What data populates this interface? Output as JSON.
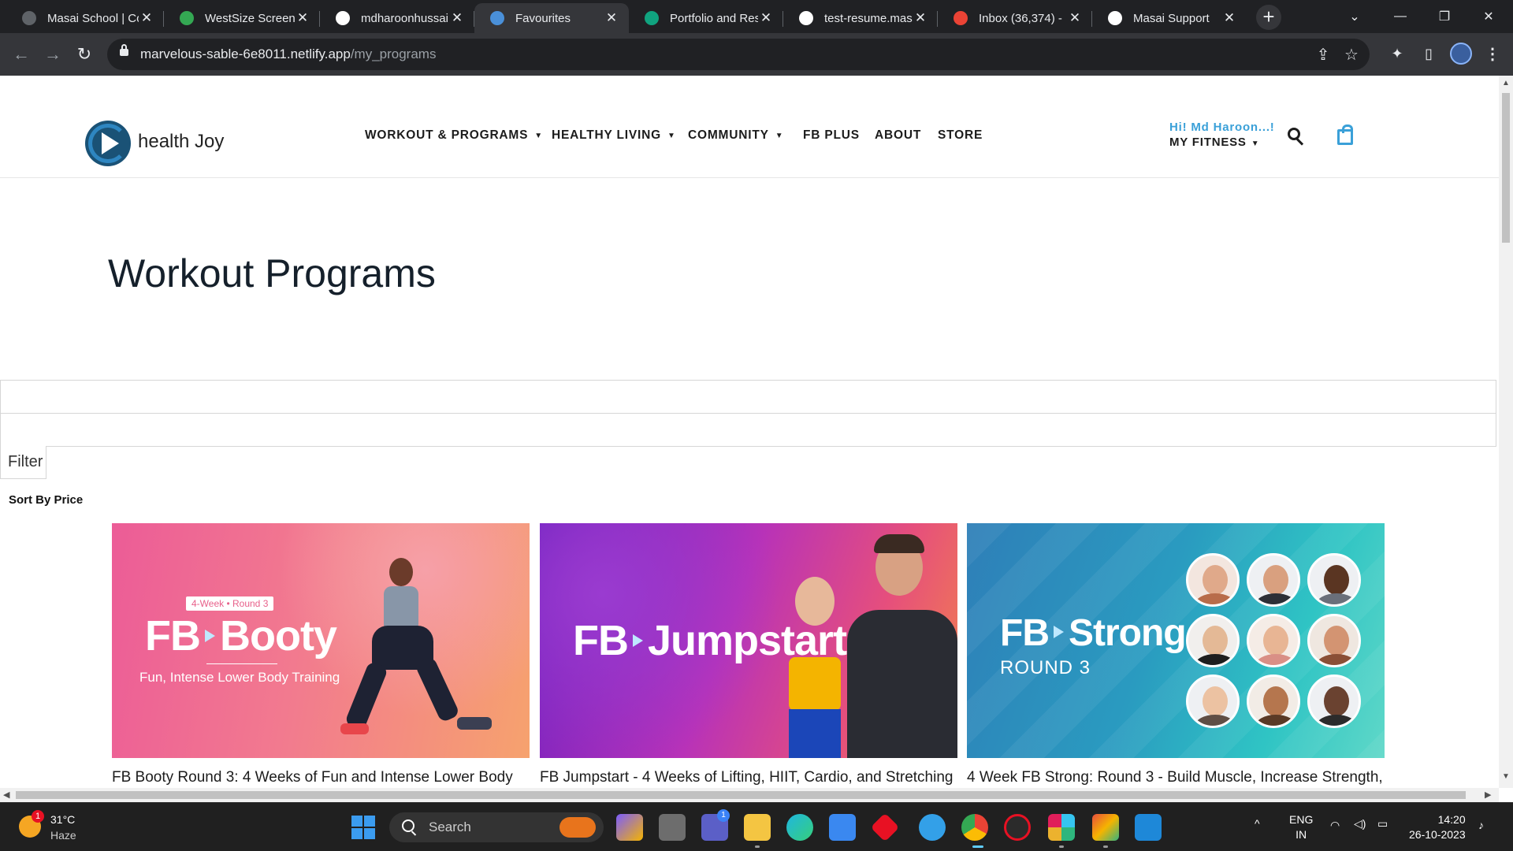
{
  "browser": {
    "tabs": [
      {
        "title": "Masai School | Co",
        "favicon_color": "#5f6368",
        "active": false
      },
      {
        "title": "WestSize Screens",
        "favicon_color": "#34a853",
        "active": false
      },
      {
        "title": "mdharoonhussai",
        "favicon_color": "#ffffff",
        "active": false
      },
      {
        "title": "Favourites",
        "favicon_color": "#4a90d9",
        "active": true
      },
      {
        "title": "Portfolio and Res",
        "favicon_color": "#10a37f",
        "active": false
      },
      {
        "title": "test-resume.mas",
        "favicon_color": "#ffffff",
        "active": false
      },
      {
        "title": "Inbox (36,374) - ",
        "favicon_color": "#ea4335",
        "active": false
      },
      {
        "title": "Masai Support",
        "favicon_color": "#ffffff",
        "active": false
      }
    ],
    "url_host": "marvelous-sable-6e8011.netlify.app",
    "url_path": "/my_programs"
  },
  "site": {
    "brand": "health Joy",
    "nav": [
      "WORKOUT & PROGRAMS",
      "HEALTHY LIVING",
      "COMMUNITY",
      "FB PLUS",
      "ABOUT",
      "STORE"
    ],
    "greeting": "Hi! Md Haroon...!",
    "my_fitness": "MY FITNESS",
    "accent_color": "#3aa0d8"
  },
  "page": {
    "title": "Workout Programs",
    "filter_label": "Filter",
    "sort_label": "Sort By Price"
  },
  "programs": [
    {
      "brand_left": "FB",
      "brand_right": "Booty",
      "tag": "4-Week • Round 3",
      "subtitle": "Fun, Intense Lower Body Training",
      "caption": "FB Booty Round 3: 4 Weeks of Fun and Intense Lower Body"
    },
    {
      "brand_left": "FB",
      "brand_right": "Jumpstart",
      "caption": "FB Jumpstart - 4 Weeks of Lifting, HIIT, Cardio, and Stretching"
    },
    {
      "brand_left": "FB",
      "brand_right": "Strong",
      "round": "ROUND 3",
      "caption": "4 Week FB Strong: Round 3 - Build Muscle, Increase Strength,"
    }
  ],
  "taskbar": {
    "weather_badge": "1",
    "temperature": "31°C",
    "condition": "Haze",
    "search_placeholder": "Search",
    "chat_badge": "1",
    "lang_top": "ENG",
    "lang_bottom": "IN",
    "time": "14:20",
    "date": "26-10-2023"
  }
}
